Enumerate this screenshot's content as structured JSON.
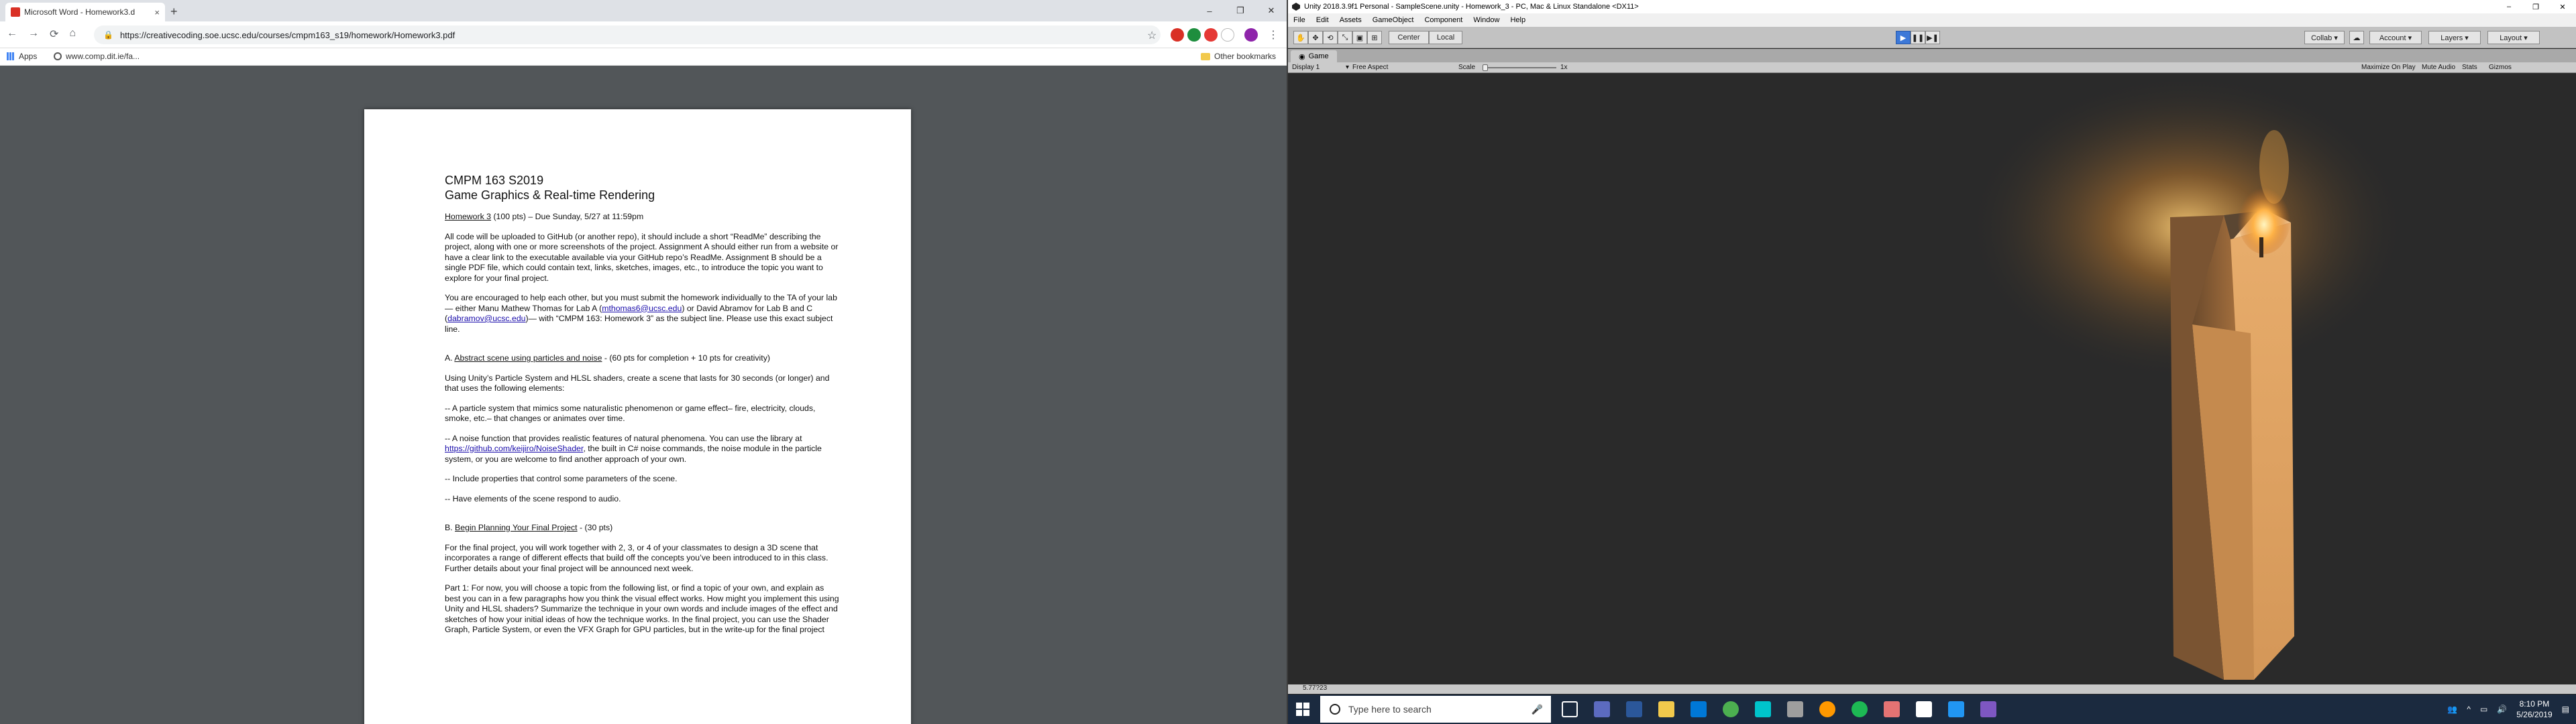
{
  "chrome": {
    "tab_title": "Microsoft Word - Homework3.d",
    "tab_close": "×",
    "new_tab": "+",
    "window_controls": [
      "–",
      "❐",
      "✕"
    ],
    "url": "https://creativecoding.soe.ucsc.edu/courses/cmpm163_s19/homework/Homework3.pdf",
    "bookmarks": {
      "apps": "Apps",
      "site": "www.comp.dit.ie/fa...",
      "other": "Other bookmarks"
    }
  },
  "pdf": {
    "course": "CMPM 163 S2019",
    "course_title": "Game Graphics & Real-time Rendering",
    "hw_link": "Homework 3",
    "hw_rest": " (100 pts) – Due Sunday, 5/27 at 11:59pm",
    "p1": "All code will be uploaded to GitHub (or another repo), it should include a short “ReadMe” describing the project, along with one or more screenshots of the project. Assignment A should either run from a website or have a clear link to the executable available via your GitHub repo’s ReadMe. Assignment B should be a single PDF file, which could contain text, links, sketches, images, etc., to introduce the topic you want to explore for your final project.",
    "p2_a": "You are encouraged to help each other, but you must submit the homework individually to the TA of your lab— either Manu Mathew Thomas for Lab A (",
    "p2_email1": "mthomas6@ucsc.edu",
    "p2_b": ") or David Abramov for Lab B and C (",
    "p2_email2": "dabramov@ucsc.edu",
    "p2_c": ")— with “CMPM 163: Homework 3” as the subject line. Please use this exact subject line.",
    "secA_prefix": "A. ",
    "secA_title": "Abstract scene using particles and noise",
    "secA_rest": " - (60 pts for completion + 10 pts for creativity)",
    "a1": "Using Unity’s Particle System and HLSL shaders, create a scene that lasts for 30 seconds (or longer) and that uses the following elements:",
    "a2": "-- A particle system that mimics some naturalistic phenomenon or game effect– fire, electricity, clouds, smoke, etc.– that changes or animates over time.",
    "a3_a": "-- A noise function that provides realistic features of natural phenomena. You can use the library at ",
    "a3_link": "https://github.com/keijiro/NoiseShader",
    "a3_b": ", the built in C# noise commands, the noise module in the particle system, or you are welcome to find another approach of your own.",
    "a4": "-- Include properties that control some parameters of the scene.",
    "a5": "-- Have elements of the scene respond to audio.",
    "secB_prefix": "B. ",
    "secB_title": "Begin Planning Your Final Project",
    "secB_rest": " - (30 pts)",
    "b1": "For the final project, you will work together with 2, 3, or 4 of your classmates to design a 3D scene that incorporates a range of different effects that build off the concepts you’ve been introduced to in this class. Further details about your final project will be announced next week.",
    "b2": "Part 1: For now, you will choose a topic from the following list, or find a topic of your own, and explain as best you can in a few paragraphs how you think the visual effect works. How might you implement this using Unity and HLSL shaders? Summarize the technique in your own words and include images of the effect and sketches of how your initial ideas of how the technique works. In the final project, you can use the Shader Graph, Particle System, or even the VFX Graph for GPU particles, but in the write-up for the final project"
  },
  "unity": {
    "window_title": "Unity 2018.3.9f1 Personal - SampleScene.unity - Homework_3 - PC, Mac & Linux Standalone <DX11>",
    "window_controls": [
      "–",
      "❐",
      "✕"
    ],
    "menu": [
      "File",
      "Edit",
      "Assets",
      "GameObject",
      "Component",
      "Window",
      "Help"
    ],
    "toolbar": {
      "pivot": "Center",
      "space": "Local",
      "collab": "Collab ▾",
      "account": "Account ▾",
      "layers": "Layers ▾",
      "layout": "Layout ▾"
    },
    "game_tab": "Game",
    "gamebar": {
      "display": "Display 1",
      "aspect": "Free Aspect",
      "scale_label": "Scale",
      "scale_value": "1x",
      "maximize": "Maximize On Play",
      "mute": "Mute Audio",
      "stats": "Stats",
      "gizmos": "Gizmos"
    },
    "status": "5.77?23"
  },
  "taskbar": {
    "search_placeholder": "Type here to search",
    "time": "8:10 PM",
    "date": "5/26/2019"
  },
  "colors": {
    "candle_wax": "#d9a066",
    "flame": "#ffb347",
    "unity_play": "#3c78d8",
    "taskbar": "#1b2a3f"
  }
}
